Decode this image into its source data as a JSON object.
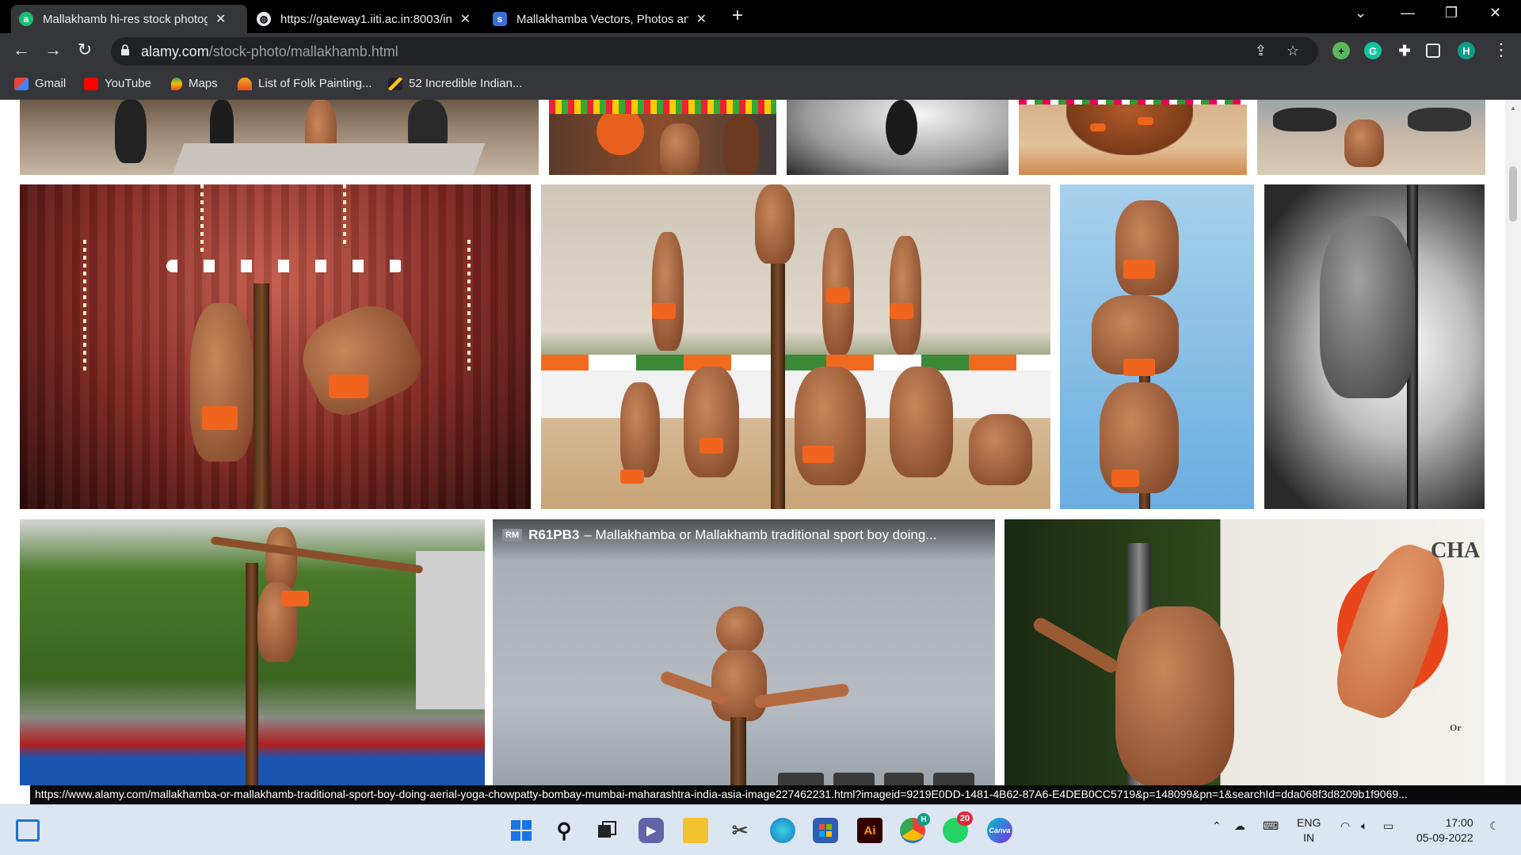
{
  "tabs": [
    {
      "title": "Mallakhamb hi-res stock photog",
      "favicon": "alamy-icon",
      "active": true
    },
    {
      "title": "https://gateway1.iiti.ac.in:8003/in",
      "favicon": "globe-icon",
      "active": false
    },
    {
      "title": "Mallakhamba Vectors, Photos an",
      "favicon": "shutterstock-icon",
      "active": false
    }
  ],
  "omnibox": {
    "domain": "alamy.com",
    "path": "/stock-photo/mallakhamb.html"
  },
  "extensions": {
    "profile_initial": "H",
    "grammarly_initial": "G"
  },
  "bookmarks": [
    {
      "label": "Gmail",
      "icon": "gmail-icon"
    },
    {
      "label": "YouTube",
      "icon": "youtube-icon"
    },
    {
      "label": "Maps",
      "icon": "maps-icon"
    },
    {
      "label": "List of Folk Painting...",
      "icon": "folk-painting-icon"
    },
    {
      "label": "52 Incredible Indian...",
      "icon": "bookmark-site-icon"
    }
  ],
  "hover_card": {
    "badge": "RM",
    "code": "R61PB3",
    "title": "– Mallakhamba or Mallakhamb traditional sport boy doing..."
  },
  "status_url": "https://www.alamy.com/mallakhamba-or-mallakhamb-traditional-sport-boy-doing-aerial-yoga-chowpatty-bombay-mumbai-maharashtra-india-asia-image227462231.html?imageid=9219E0DD-1481-4B62-87A6-E4DEB0CC5719&p=148099&pn=1&searchId=dda068f3d8209b1f9069...",
  "poster_text": {
    "top": "CHA",
    "bottom": "Or"
  },
  "taskbar": {
    "whatsapp_badge": "20",
    "chrome_badge": "H",
    "illustrator_label": "Ai",
    "canva_label": "Canva",
    "lang_top": "ENG",
    "lang_bottom": "IN",
    "time": "17:00",
    "date": "05-09-2022"
  }
}
